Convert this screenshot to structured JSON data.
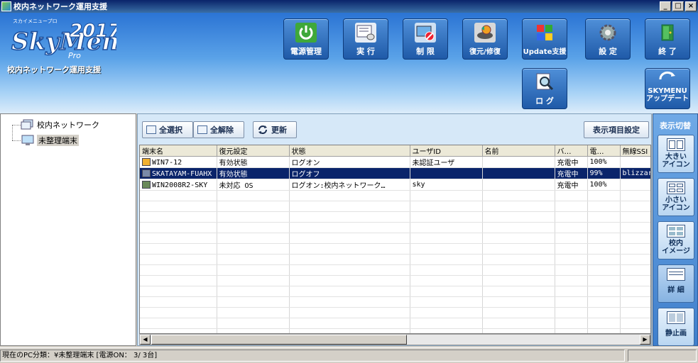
{
  "window": {
    "title": "校内ネットワーク運用支援",
    "controls": [
      "_",
      "□",
      "×"
    ]
  },
  "header": {
    "logo_small": "スカイメニュープロ",
    "logo_main": "SkyMenu",
    "logo_year": "2017",
    "logo_pro": "Pro",
    "subtitle": "校内ネットワーク運用支援",
    "buttons": [
      {
        "label": "電源管理",
        "icon": "power-icon"
      },
      {
        "label": "実 行",
        "icon": "run-icon"
      },
      {
        "label": "制 限",
        "icon": "restrict-icon"
      },
      {
        "label": "復元/修復",
        "icon": "restore-icon"
      },
      {
        "label": "Update支援",
        "icon": "update-icon"
      },
      {
        "label": "設 定",
        "icon": "gear-icon"
      },
      {
        "label": "終 了",
        "icon": "exit-door-icon"
      }
    ],
    "log_button": {
      "label": "ロ グ",
      "icon": "log-magnifier-icon"
    },
    "update_button": {
      "label1": "SKYMENU",
      "label2": "アップデート",
      "icon": "skymenu-update-icon"
    }
  },
  "tree": {
    "root": "校内ネットワーク",
    "child": "未整理端末"
  },
  "toolbar": {
    "select_all": "全選択",
    "deselect_all": "全解除",
    "refresh": "更新",
    "display_settings": "表示項目設定"
  },
  "table": {
    "columns": [
      "端末名",
      "復元設定",
      "状態",
      "ユーザID",
      "名前",
      "バ…",
      "電…",
      "無線SSI"
    ],
    "rows": [
      {
        "name": "WIN7-12",
        "restore": "有効状態",
        "status": "ログオン",
        "user": "未認証ユーザ",
        "fullname": "",
        "battery": "充電中",
        "power": "100%",
        "ssid": ""
      },
      {
        "name": "SKATAYAM-FUAHX",
        "restore": "有効状態",
        "status": "ログオフ",
        "user": "",
        "fullname": "",
        "battery": "充電中",
        "power": "99%",
        "ssid": "blizzar"
      },
      {
        "name": "WIN2008R2-SKY",
        "restore": "未対応 OS",
        "status": "ログオン:校内ネットワーク…",
        "user": "sky",
        "fullname": "",
        "battery": "充電中",
        "power": "100%",
        "ssid": ""
      }
    ],
    "selected_row": 1
  },
  "view_panel": {
    "title": "表示切替",
    "buttons": [
      {
        "label": "大きい\nアイコン"
      },
      {
        "label": "小さい\nアイコン"
      },
      {
        "label": "校内\nイメージ"
      },
      {
        "label": "詳 細"
      },
      {
        "label": "静止画"
      }
    ],
    "active": 3
  },
  "status": {
    "text": "現在のPC分類：¥未整理端末 [電源ON：  3/  3台]"
  },
  "colors": {
    "header_top": "#2b74d4",
    "selection": "#0a246a",
    "titlebar": "#0a246a"
  }
}
